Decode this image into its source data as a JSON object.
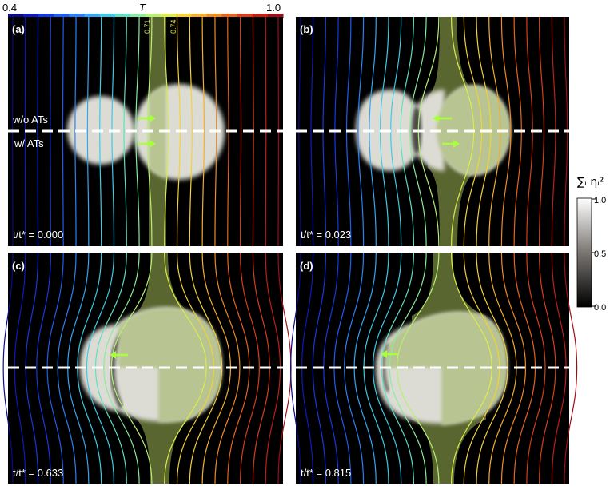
{
  "colorbar_top": {
    "min_label": "0.4",
    "max_label": "1.0",
    "title": "T",
    "colors": [
      "#0a0a8c",
      "#0d1ac0",
      "#1438e0",
      "#1e5cf0",
      "#2a80f8",
      "#34a6f6",
      "#3ccbe6",
      "#5ee0c4",
      "#8aec9c",
      "#b6f074",
      "#dcec48",
      "#f4d23a",
      "#f6ae2e",
      "#f08a24",
      "#e8641e",
      "#d83e18",
      "#c01e16",
      "#a00c14"
    ]
  },
  "isotherm_labels": [
    "0.71",
    "0.74"
  ],
  "panels": [
    {
      "label": "(a)",
      "time_text": "t/t* = 0.000"
    },
    {
      "label": "(b)",
      "time_text": "t/t* = 0.023"
    },
    {
      "label": "(c)",
      "time_text": "t/t* = 0.633"
    },
    {
      "label": "(d)",
      "time_text": "t/t* = 0.815"
    }
  ],
  "annotations": {
    "without_ats": "w/o ATs",
    "with_ats": "w/ ATs"
  },
  "colorbar_right": {
    "title": "∑ᵢ ηᵢ²",
    "ticks": [
      "1.0",
      "0.5",
      "0.0"
    ]
  },
  "colors": {
    "arrow": "#a8ff3c",
    "grain_white": "#dcdcd4",
    "grain_green": "#b4c090",
    "band_green": "#5a6630",
    "background": "#000000",
    "dashed_line": "#ffffff"
  }
}
